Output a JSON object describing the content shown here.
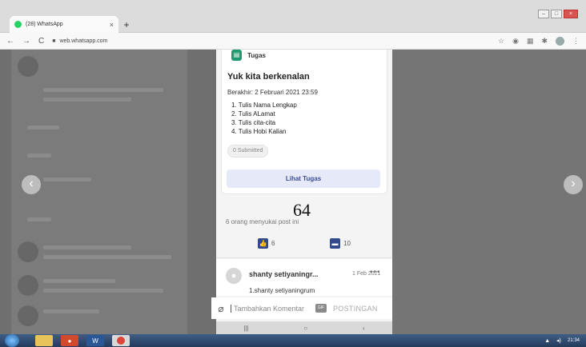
{
  "browser": {
    "tab_title": "(28) WhatsApp",
    "url": "web.whatsapp.com"
  },
  "post": {
    "type_label": "Tugas",
    "title": "Yuk kita berkenalan",
    "deadline": "Berakhir: 2 Februari 2021 23:59",
    "items": [
      "1. Tulis Nama Lengkap",
      "2. Tulis ALamat",
      "3. Tulis cita-cita",
      "4. Tulis Hobi Kalian"
    ],
    "submitted": "0 Submitted",
    "button_label": "Lihat Tugas",
    "page_number": "64",
    "likes_text": "6 orang menyukai post ini",
    "like_count": "6",
    "comment_count": "10"
  },
  "comment": {
    "author": "shanty setiyaningr...",
    "date": "1 Feb 2021",
    "text": "1.shanty setiyaningrum"
  },
  "composer": {
    "placeholder": "Tambahkan Komentar",
    "gif_label": "GIF",
    "post_label": "POSTINGAN"
  },
  "taskbar": {
    "time": "21:34"
  }
}
